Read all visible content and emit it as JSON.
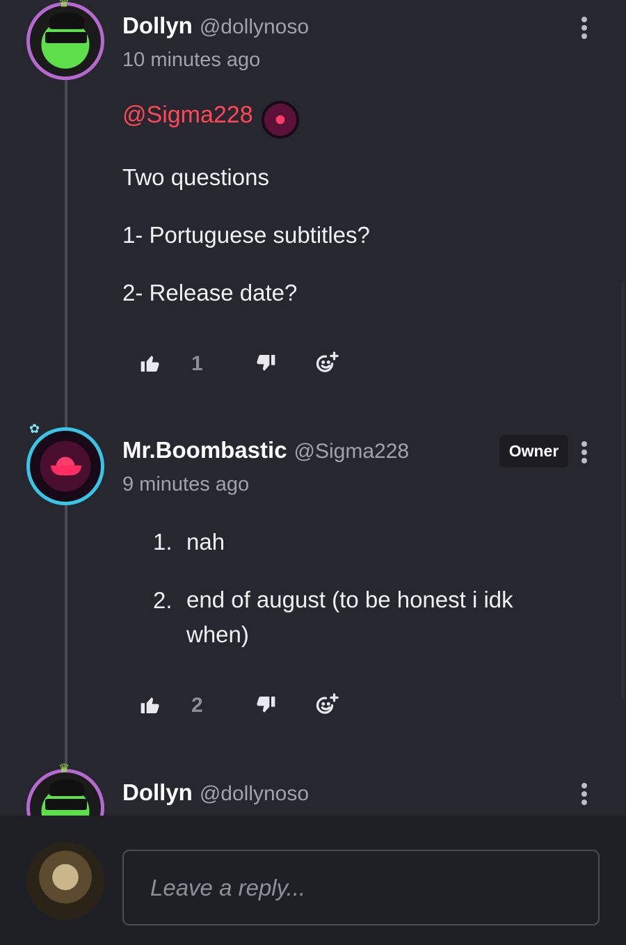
{
  "comments": [
    {
      "author": "Dollyn",
      "handle": "@dollynoso",
      "time": "10 minutes ago",
      "mention": "@Sigma228",
      "paragraphs": [
        "Two questions",
        "1- Portuguese subtitles?",
        "2- Release date?"
      ],
      "likes": "1"
    },
    {
      "author": "Mr.Boombastic",
      "handle": "@Sigma228",
      "badge": "Owner",
      "time": "9 minutes ago",
      "list": [
        {
          "num": "1.",
          "text": "nah"
        },
        {
          "num": "2.",
          "text": "end of august (to be honest i idk when)"
        }
      ],
      "likes": "2"
    },
    {
      "author": "Dollyn",
      "handle": "@dollynoso"
    }
  ],
  "reply": {
    "placeholder": "Leave a reply..."
  },
  "icons": {
    "like": "thumbs-up-icon",
    "dislike": "thumbs-down-icon",
    "react": "add-reaction-icon",
    "menu": "more-vertical-icon"
  },
  "colors": {
    "background": "#272730",
    "mention": "#ff4757",
    "muted": "#a2a2ad"
  }
}
